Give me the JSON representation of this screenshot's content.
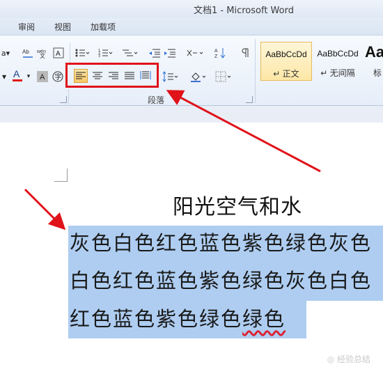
{
  "window": {
    "title": "文档1  -  Microsoft Word"
  },
  "tabs": [
    "审阅",
    "视图",
    "加载项"
  ],
  "ribbon": {
    "group_paragraph_label": "段落",
    "align_buttons": [
      {
        "name": "align-left",
        "active": true
      },
      {
        "name": "align-center",
        "active": false
      },
      {
        "name": "align-right",
        "active": false
      },
      {
        "name": "justify",
        "active": false
      },
      {
        "name": "distributed",
        "active": false
      }
    ],
    "styles": [
      {
        "sample": "AaBbCcDd",
        "name": "↵ 正文",
        "selected": true
      },
      {
        "sample": "AaBbCcDd",
        "name": "↵ 无间隔",
        "selected": false
      },
      {
        "sample": "Aa",
        "name": "标",
        "selected": false
      }
    ],
    "font_color": "#e01818",
    "highlight_color": "#f8c765"
  },
  "document": {
    "title": "阳光空气和水",
    "lines": [
      "灰色白色红色蓝色紫色绿色灰色",
      "白色红色蓝色紫色绿色灰色白色",
      "红色蓝色紫色绿色"
    ],
    "last_word": "绿色",
    "selection_color": "#aecdf1"
  },
  "annotation": {
    "color": "#e0121a"
  },
  "watermark": "◎ 经验总结"
}
